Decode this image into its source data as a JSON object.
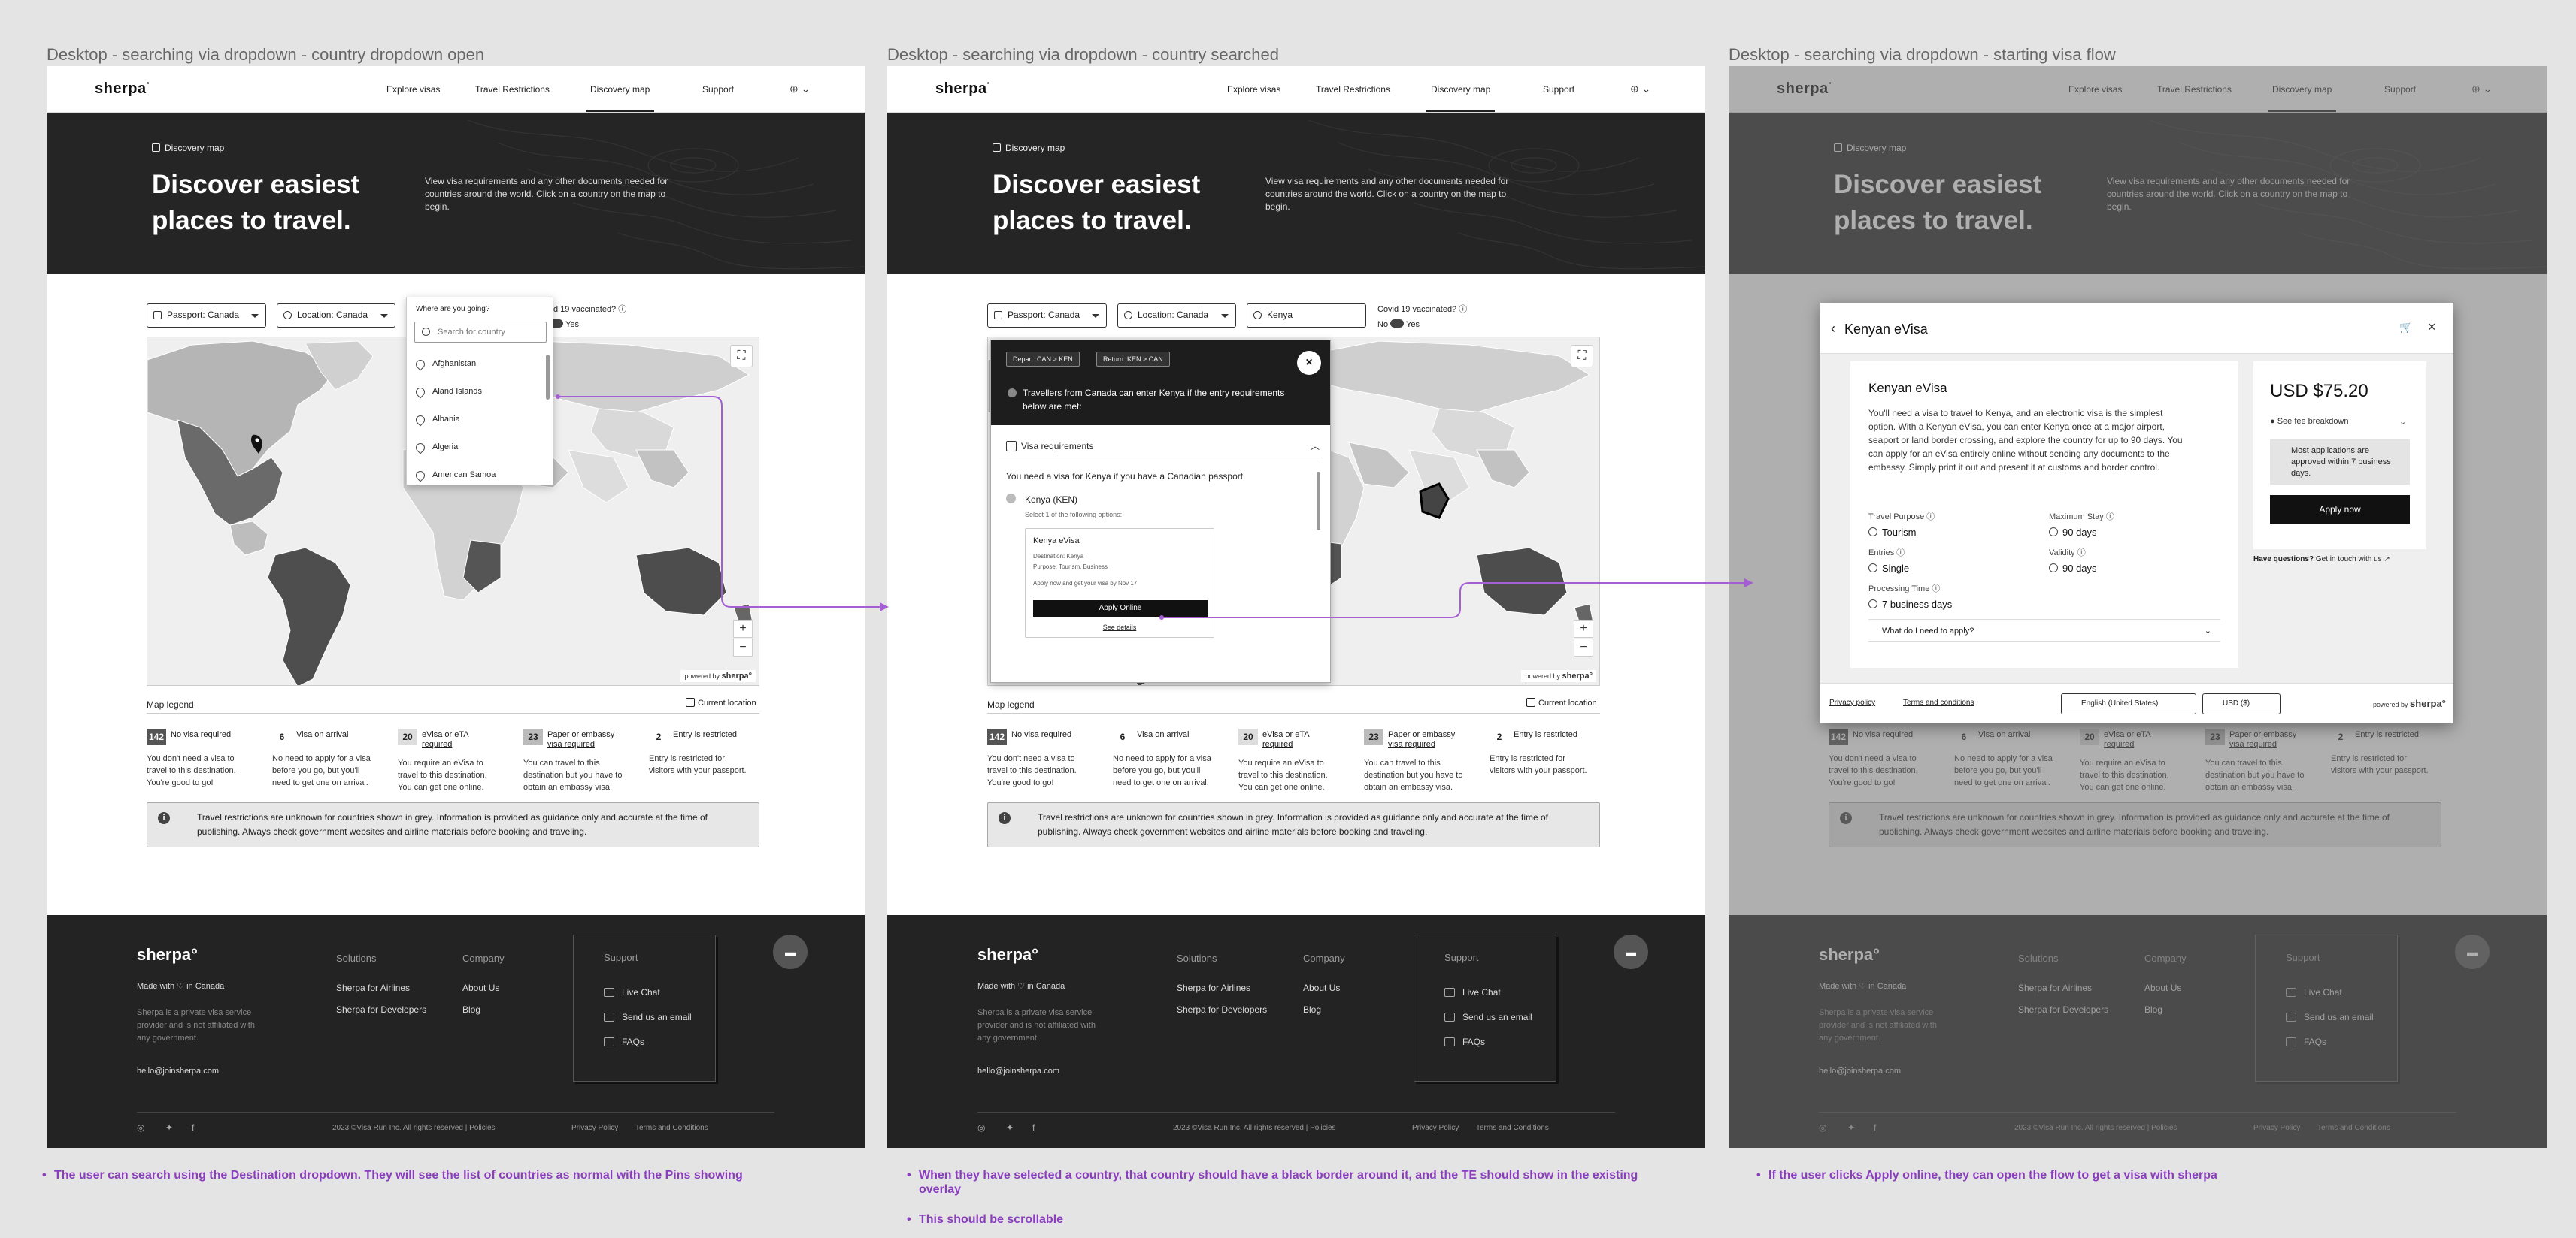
{
  "frames": [
    {
      "title": "Desktop - searching via dropdown - country dropdown open"
    },
    {
      "title": "Desktop - searching via dropdown - country searched"
    },
    {
      "title": "Desktop - searching via dropdown - starting visa flow"
    }
  ],
  "nav": {
    "logo": "sherpa",
    "logo_mark": "°",
    "items": [
      "Explore visas",
      "Travel Restrictions",
      "Discovery map",
      "Support"
    ],
    "active_item": "Discovery map",
    "language_icon": "globe-icon"
  },
  "hero": {
    "breadcrumb": "Discovery map",
    "title": "Discover easiest places to travel.",
    "description": "View visa requirements and any other documents needed for countries around the world. Click on a country on the map to begin."
  },
  "filters": {
    "passport": "Passport: Canada",
    "location": "Location: Canada",
    "destination_searched": "Kenya",
    "covid_label": "Covid 19 vaccinated?",
    "covid_no": "No",
    "covid_yes": "Yes"
  },
  "destination_dropdown": {
    "title": "Where are you going?",
    "placeholder": "Search for country",
    "countries": [
      "Afghanistan",
      "Aland Islands",
      "Albania",
      "Algeria",
      "American Samoa"
    ]
  },
  "map": {
    "powered_by": "powered by",
    "powered_logo": "sherpa°",
    "zoom_in": "+",
    "zoom_out": "−"
  },
  "legend": {
    "title": "Map legend",
    "current_location": "Current location",
    "items": [
      {
        "count": "142",
        "label": "No visa required",
        "desc": "You don't need a visa to travel to this destination. You're good to go!"
      },
      {
        "count": "6",
        "label": "Visa on arrival",
        "desc": "No need to apply for a visa before you go, but you'll need to get one on arrival."
      },
      {
        "count": "20",
        "label": "eVisa or eTA required",
        "desc": "You require an eVisa to travel to this destination. You can get one online."
      },
      {
        "count": "23",
        "label": "Paper or embassy visa required",
        "desc": "You can travel to this destination but you have to obtain an embassy visa."
      },
      {
        "count": "2",
        "label": "Entry is restricted",
        "desc": "Entry is restricted for visitors with your passport."
      }
    ]
  },
  "notice": "Travel restrictions are unknown for countries shown in grey. Information is provided as guidance only and accurate at the time of publishing. Always check government websites and airline materials before booking and traveling.",
  "overlay": {
    "depart_chip": "Depart: CAN > KEN",
    "return_chip": "Return: KEN > CAN",
    "headline": "Travellers from Canada can enter Kenya if the entry requirements below are met:",
    "section": "Visa requirements",
    "need": "You need a visa for Kenya if you have a Canadian passport.",
    "country": "Kenya (KEN)",
    "select_hint": "Select 1 of the following options:",
    "card_title": "Kenya eVisa",
    "card_destination": "Destination: Kenya",
    "card_purpose": "Purpose: Tourism, Business",
    "card_note": "Apply now and get your visa by Nov 17",
    "apply": "Apply Online",
    "see_details": "See details"
  },
  "modal": {
    "title": "Kenyan eVisa",
    "heading": "Kenyan eVisa",
    "description": "You'll need a visa to travel to Kenya, and an electronic visa is the simplest option. With a Kenyan eVisa, you can enter Kenya once at a major airport, seaport or land border crossing, and explore the country for up to 90 days. You can apply for an eVisa entirely online without sending any documents to the embassy. Simply print it out and present it at customs and border control.",
    "fields": [
      {
        "label": "Travel Purpose",
        "value": "Tourism"
      },
      {
        "label": "Maximum Stay",
        "value": "90 days"
      },
      {
        "label": "Entries",
        "value": "Single"
      },
      {
        "label": "Validity",
        "value": "90 days"
      },
      {
        "label": "Processing Time",
        "value": "7 business days"
      }
    ],
    "question": "What do I need to apply?",
    "price": "USD $75.20",
    "fee_breakdown": "See fee breakdown",
    "approval_note": "Most applications are approved within 7 business days.",
    "apply_now": "Apply now",
    "have_questions": "Have questions?",
    "get_in_touch": "Get in touch with us",
    "privacy": "Privacy policy",
    "terms": "Terms and conditions",
    "language": "English (United States)",
    "currency": "USD ($)",
    "powered_by": "powered by",
    "powered_logo": "sherpa°"
  },
  "footer": {
    "logo": "sherpa°",
    "made_with": "Made with ♡ in Canada",
    "description": "Sherpa is a private visa service provider and is not affiliated with any government.",
    "email": "hello@joinsherpa.com",
    "solutions_head": "Solutions",
    "solutions": [
      "Sherpa for Airlines",
      "Sherpa for Developers"
    ],
    "company_head": "Company",
    "company": [
      "About Us",
      "Blog"
    ],
    "support_head": "Support",
    "support": [
      "Live Chat",
      "Send us an email",
      "FAQs"
    ],
    "copyright": "2023 ©Visa Run Inc. All rights reserved | Policies",
    "privacy": "Privacy Policy",
    "terms": "Terms and Conditions",
    "social": [
      "instagram-icon",
      "twitter-icon",
      "facebook-icon"
    ]
  },
  "annotations": [
    "The user can search using the Destination dropdown. They will see the list of countries as normal with the Pins showing",
    "When they have selected a country, that country should have a black border around it, and the TE should show in the existing overlay",
    "This should be scrollable",
    "If the user clicks Apply online, they can open the flow to get a visa with sherpa"
  ],
  "colors": {
    "annotation": "#8a3dbd",
    "hero_bg": "#252525",
    "footer_bg": "#232323"
  }
}
